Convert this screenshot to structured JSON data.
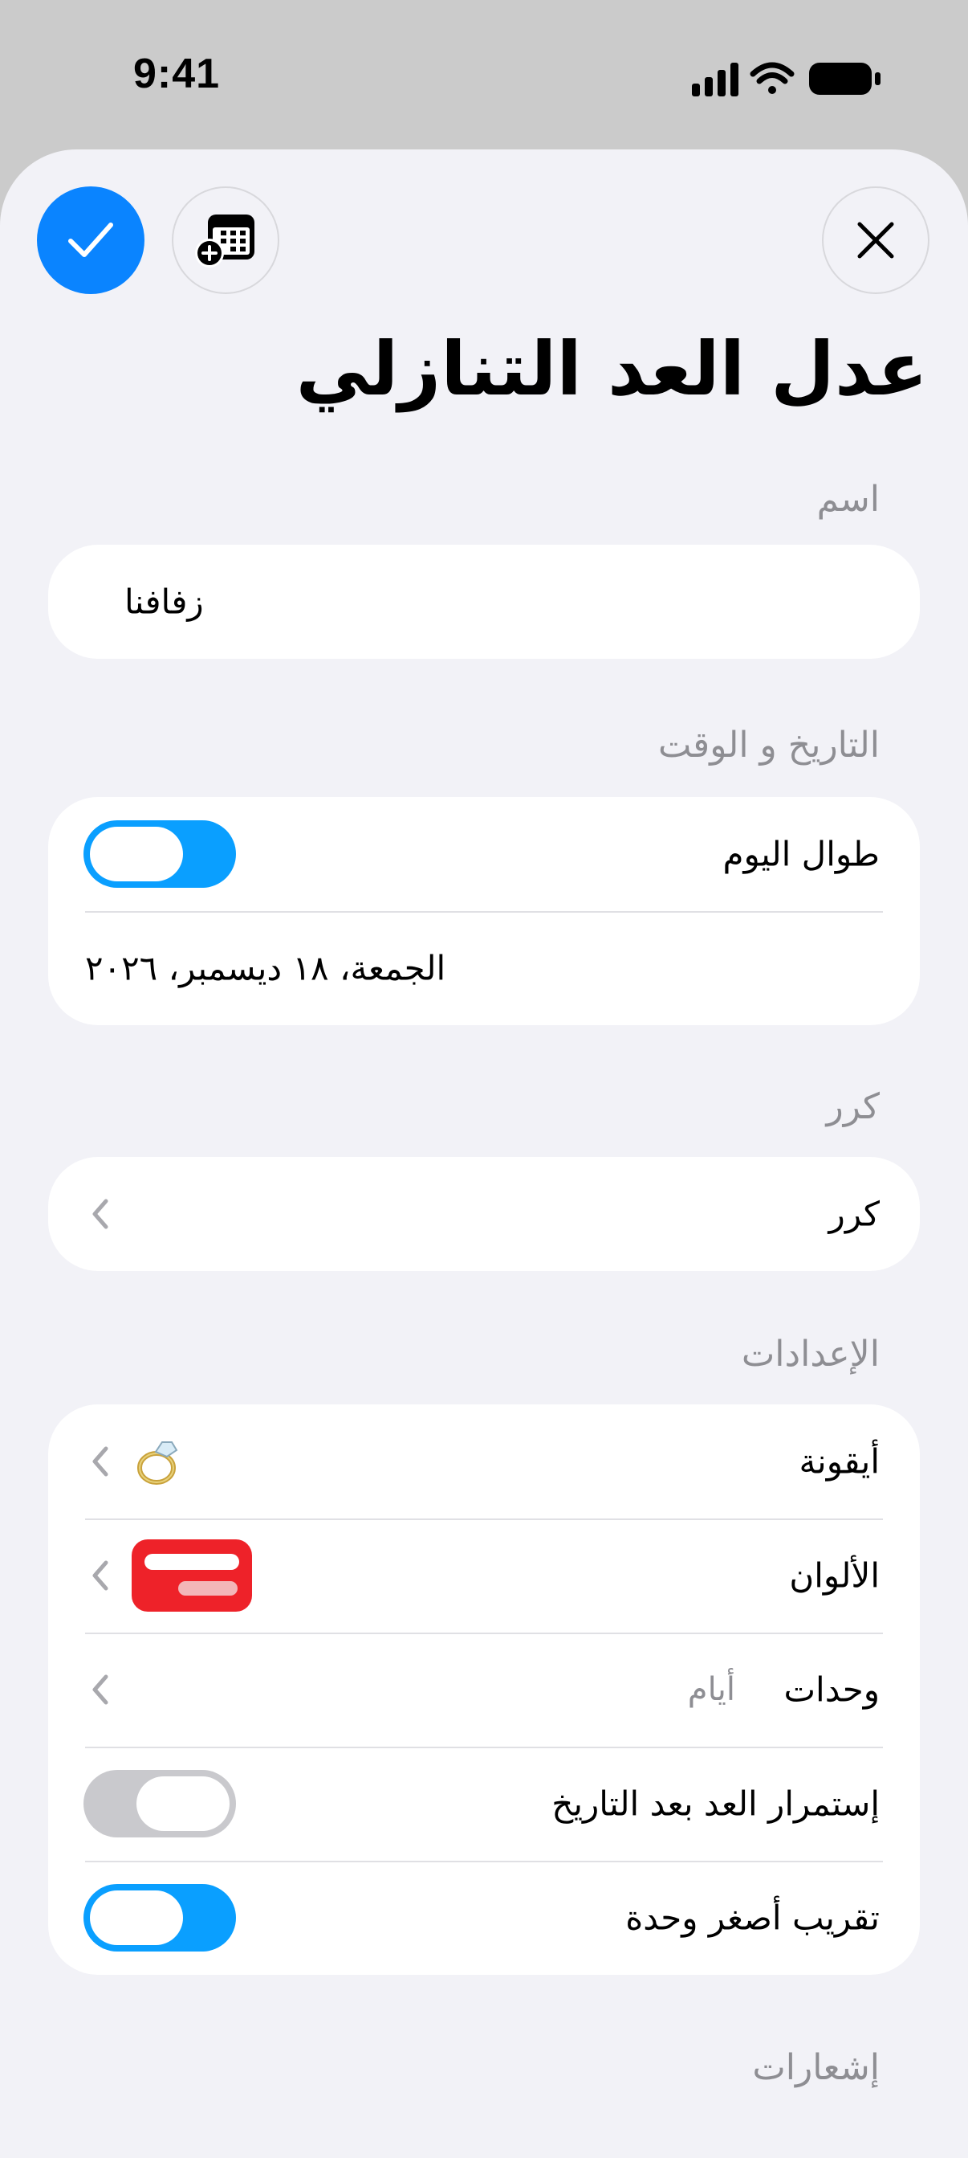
{
  "status_bar": {
    "time": "9:41"
  },
  "header": {
    "title": "عدل العد التنازلي"
  },
  "sections": {
    "name": {
      "label": "اسم",
      "value": "زفافنا"
    },
    "datetime": {
      "label": "التاريخ و الوقت",
      "all_day_label": "طوال اليوم",
      "all_day_on": true,
      "date_value": "الجمعة، ١٨ ديسمبر، ٢٠٢٦"
    },
    "repeat": {
      "label": "كرر",
      "row_label": "كرر"
    },
    "settings": {
      "label": "الإعدادات",
      "icon_label": "أيقونة",
      "icon_value": "ring-emoji-icon",
      "colors_label": "الألوان",
      "color_value": "#ee2229",
      "units_label": "وحدات",
      "units_value": "أيام",
      "continue_label": "إستمرار العد بعد التاريخ",
      "continue_on": false,
      "round_label": "تقريب أصغر وحدة",
      "round_on": true
    },
    "notifications": {
      "label": "إشعارات"
    }
  },
  "colors": {
    "accent": "#0a84ff",
    "toggle_on": "#0a9fff",
    "sheet_bg": "#f2f2f7",
    "swatch_red": "#ee2229"
  }
}
